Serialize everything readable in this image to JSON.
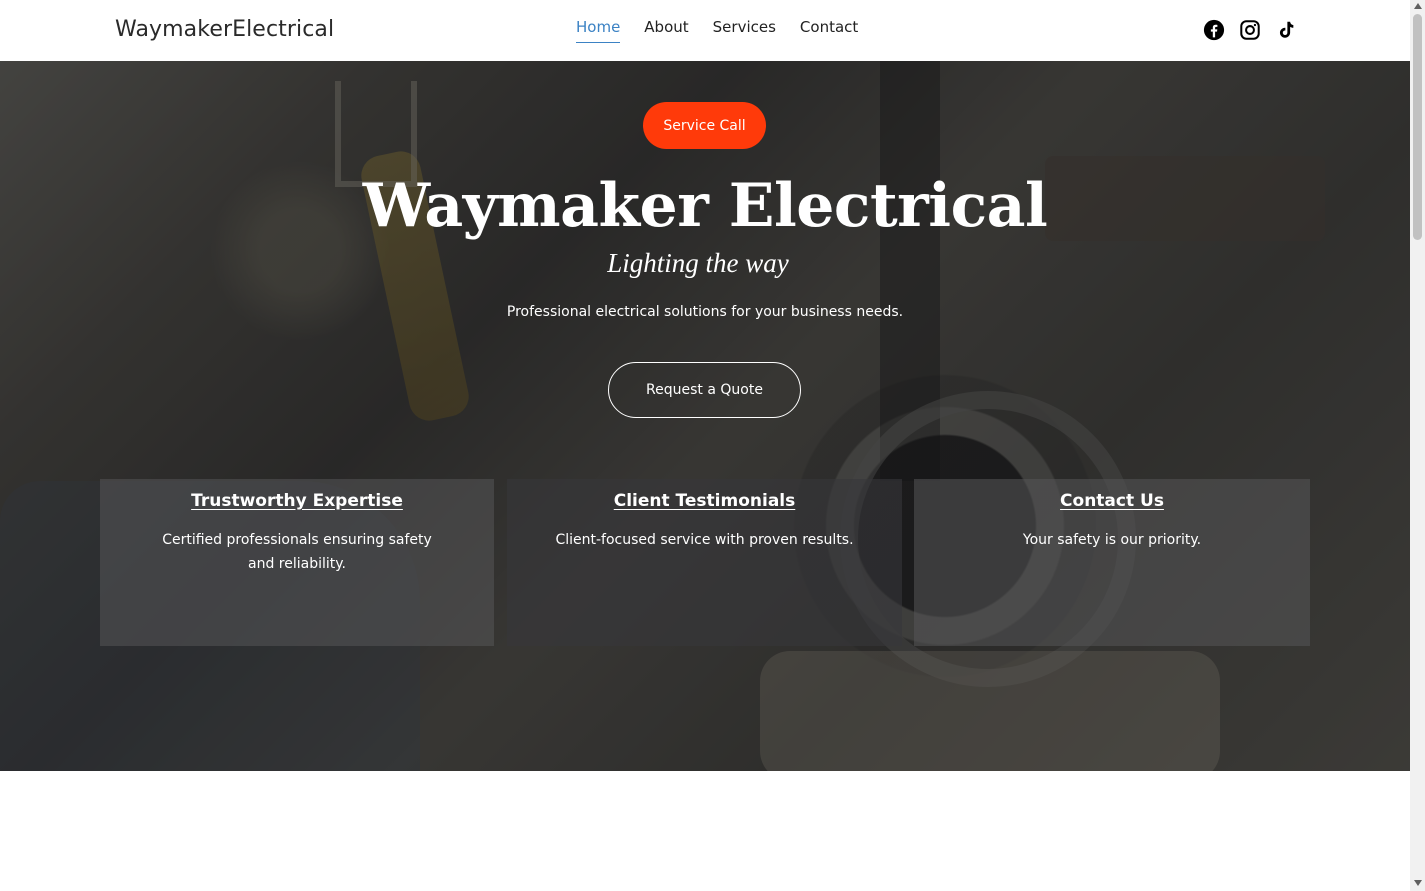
{
  "nav": {
    "logo": "WaymakerElectrical",
    "items": [
      {
        "label": "Home",
        "active": true
      },
      {
        "label": "About",
        "active": false
      },
      {
        "label": "Services",
        "active": false
      },
      {
        "label": "Contact",
        "active": false
      }
    ],
    "social_icons": [
      "facebook-icon",
      "instagram-icon",
      "tiktok-icon"
    ]
  },
  "hero": {
    "service_button": "Service Call",
    "title": "Waymaker Electrical",
    "tagline": "Lighting the way",
    "description": "Professional electrical solutions for your business needs.",
    "quote_button": "Request a Quote"
  },
  "cards": [
    {
      "title": "Trustworthy Expertise",
      "text": "Certified professionals ensuring safety and reliability."
    },
    {
      "title": "Client Testimonials",
      "text": "Client-focused service with proven results."
    },
    {
      "title": "Contact Us",
      "text": "Your safety is our priority."
    }
  ],
  "colors": {
    "accent": "#ff3a0a",
    "nav_active": "#3b82c4",
    "text_dark": "#222222"
  }
}
